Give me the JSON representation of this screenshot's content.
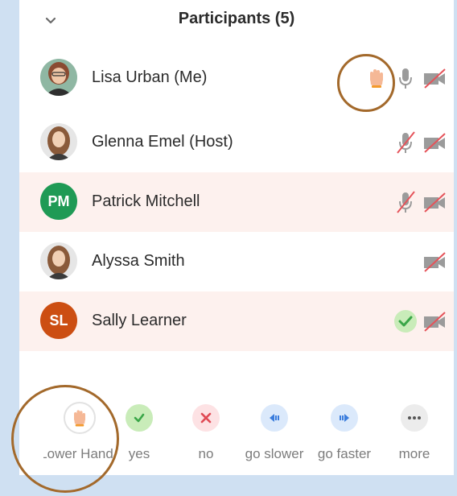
{
  "header": {
    "title": "Participants (5)"
  },
  "participants": [
    {
      "name": "Lisa Urban (Me)",
      "avatar": "photo",
      "hand_raised": true,
      "mic": "on",
      "video": "off"
    },
    {
      "name": "Glenna Emel  (Host)",
      "avatar": "photo",
      "mic": "muted",
      "video": "off"
    },
    {
      "name": "Patrick Mitchell",
      "initials": "PM",
      "avatar_color": "#1f9a55",
      "mic": "muted",
      "video": "off"
    },
    {
      "name": "Alyssa Smith",
      "avatar": "photo",
      "video": "off"
    },
    {
      "name": "Sally Learner",
      "initials": "SL",
      "avatar_color": "#cc4e12",
      "status": "yes",
      "video": "off"
    }
  ],
  "reactions": [
    {
      "label": "Lower Hand",
      "icon": "raised-hand-icon"
    },
    {
      "label": "yes",
      "icon": "check-icon"
    },
    {
      "label": "no",
      "icon": "x-icon"
    },
    {
      "label": "go slower",
      "icon": "rewind-icon"
    },
    {
      "label": "go faster",
      "icon": "fast-forward-icon"
    },
    {
      "label": "more",
      "icon": "ellipsis-icon"
    }
  ],
  "colors": {
    "shaded_row": "#fdf1ee",
    "highlight_ring": "#a3692b",
    "mute_slash": "#e5535a",
    "background": "#cfe0f2"
  }
}
